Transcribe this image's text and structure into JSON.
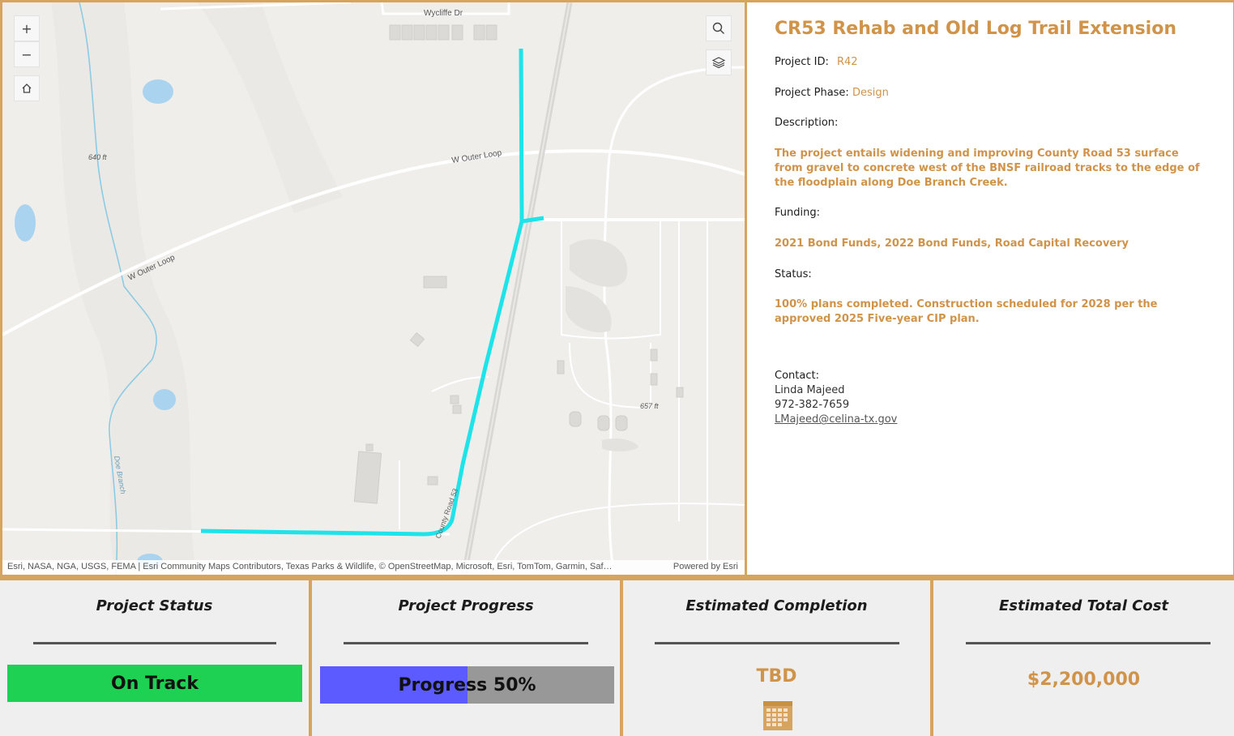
{
  "map": {
    "labels": {
      "wycliffe": "Wycliffe Dr",
      "outer_loop_1": "W Outer Loop",
      "outer_loop_2": "W Outer Loop",
      "elev_1": "640 ft",
      "elev_2": "657 ft",
      "doe_branch": "Doe Branch",
      "county_road": "County Road 53"
    },
    "controls": {
      "zoom_in": "+",
      "zoom_out": "−"
    },
    "attribution": "Esri, NASA, NGA, USGS, FEMA | Esri Community Maps Contributors, Texas Parks & Wildlife, © OpenStreetMap, Microsoft, Esri, TomTom, Garmin, Saf…",
    "powered_by": "Powered by Esri",
    "route_color": "#1ee3e8"
  },
  "project": {
    "title": "CR53 Rehab and Old Log Trail Extension",
    "id_label": "Project ID:",
    "id_value": "R42",
    "phase_label": "Project Phase:",
    "phase_value": "Design",
    "description_label": "Description:",
    "description": "The project entails widening and improving County Road 53 surface from gravel to concrete west of the BNSF railroad tracks to the edge of the floodplain along Doe Branch Creek.",
    "funding_label": "Funding:",
    "funding": "2021 Bond Funds, 2022 Bond Funds, Road Capital Recovery",
    "status_label": "Status:",
    "status": "100% plans completed. Construction scheduled for 2028 per the approved 2025 Five-year CIP plan.",
    "contact_label": "Contact:",
    "contact_name": "Linda Majeed",
    "contact_phone": "972-382-7659",
    "contact_email": "LMajeed@celina-tx.gov"
  },
  "cards": {
    "status_title": "Project Status",
    "status_value": "On Track",
    "status_color": "#1ed153",
    "progress_title": "Project Progress",
    "progress_text": "Progress 50%",
    "progress_fraction": 0.5,
    "completion_title": "Estimated Completion",
    "completion_value": "TBD",
    "cost_title": "Estimated Total Cost",
    "cost_value": "$2,200,000"
  },
  "colors": {
    "accent": "#d6a45f",
    "text_accent": "#d0934a",
    "progress_fill": "#5b5bff"
  },
  "icons": [
    "zoom-in-icon",
    "zoom-out-icon",
    "home-icon",
    "search-icon",
    "layers-icon",
    "calendar-icon"
  ]
}
